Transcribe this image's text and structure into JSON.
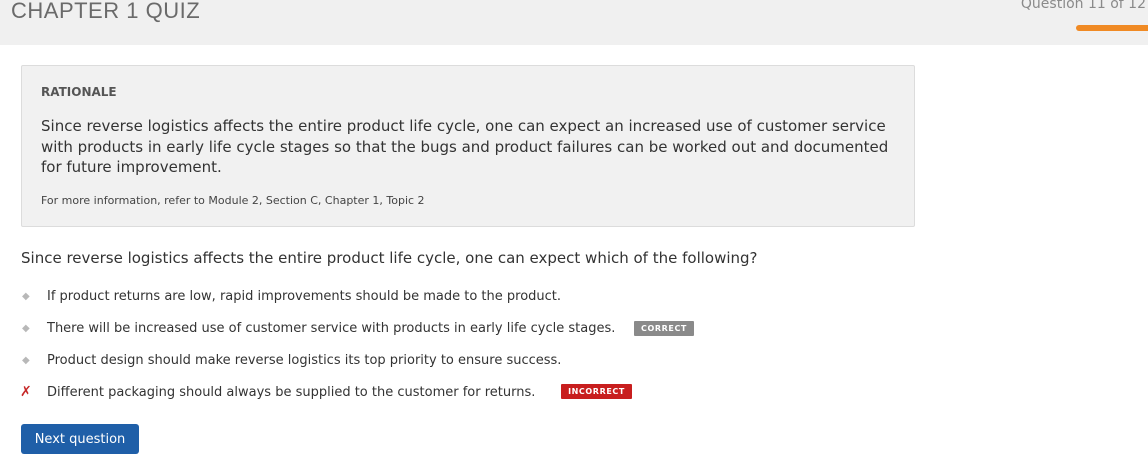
{
  "header": {
    "title": "CHAPTER 1 QUIZ",
    "progress_text": "Question 11 of 12",
    "progress": {
      "current": 11,
      "total": 12
    },
    "accent_color": "#f08a24"
  },
  "rationale": {
    "heading": "RATIONALE",
    "body": "Since reverse logistics affects the entire product life cycle, one can expect an increased use of customer service with products in early life cycle stages so that the bugs and product failures can be worked out and documented for future improvement.",
    "reference": "For more information, refer to Module 2, Section C, Chapter 1, Topic 2"
  },
  "question": {
    "text": "Since reverse logistics affects the entire product life cycle, one can expect which of the following?"
  },
  "answers": [
    {
      "label": "If product returns are low, rapid improvements should be made to the product.",
      "marker": "◆",
      "badge": ""
    },
    {
      "label": "There will be increased use of customer service with products in early life cycle stages.",
      "marker": "◆",
      "badge": "CORRECT",
      "badge_color": "#8a8a8a"
    },
    {
      "label": "Product design should make reverse logistics its top priority to ensure success.",
      "marker": "◆",
      "badge": ""
    },
    {
      "label": "Different packaging should always be supplied to the customer for returns.",
      "marker": "✗",
      "badge": "INCORRECT",
      "badge_color": "#c81e1e"
    }
  ],
  "next_button": {
    "label": "Next question",
    "color": "#1f5fa8"
  }
}
